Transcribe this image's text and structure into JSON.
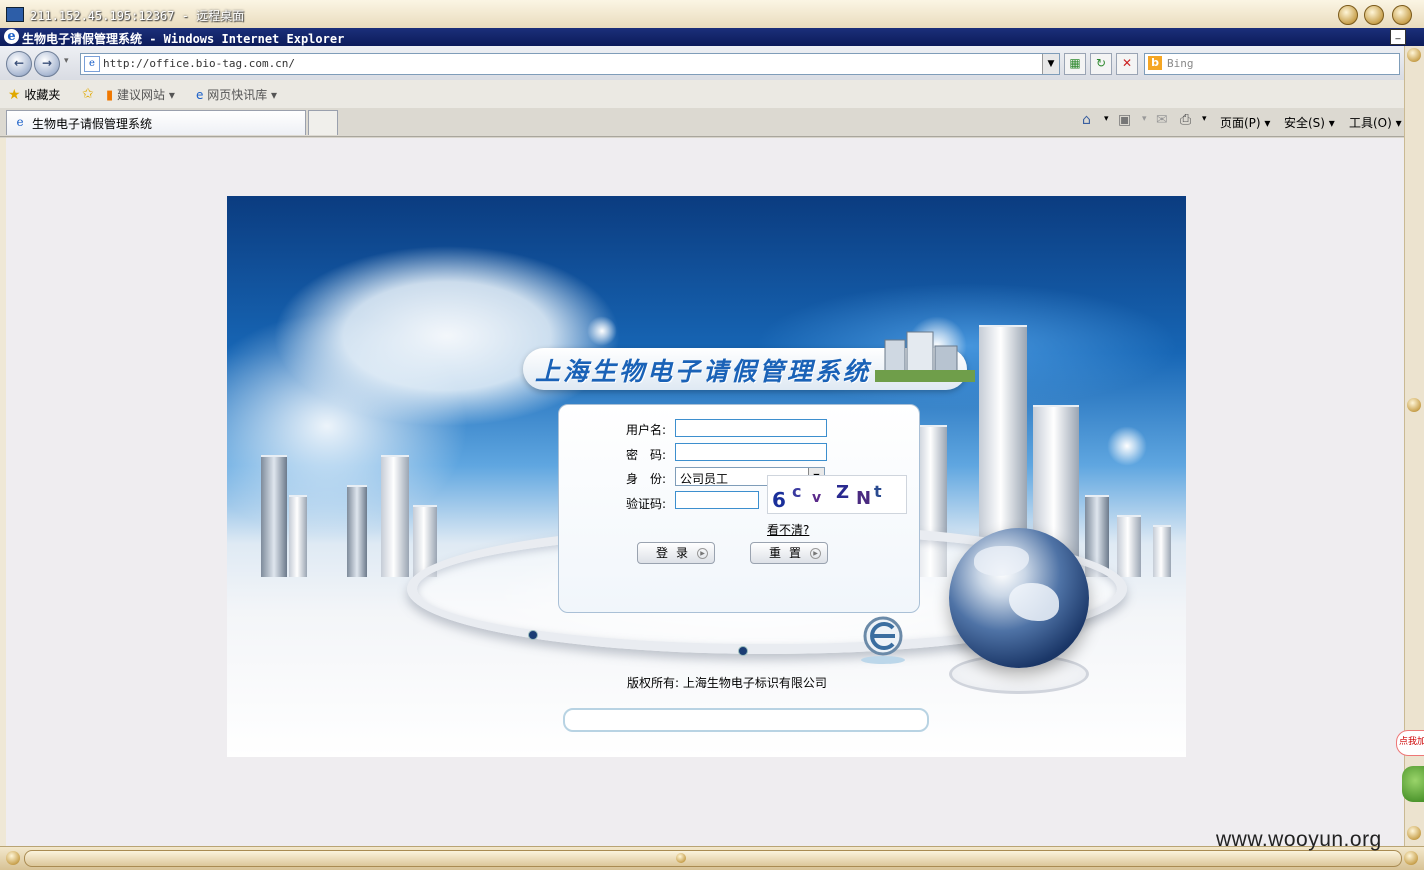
{
  "remote_desktop": {
    "title": "211.152.45.195:12367 - 远程桌面"
  },
  "browser": {
    "window_title": "生物电子请假管理系统 - Windows Internet Explorer",
    "address": "http://office.bio-tag.com.cn/",
    "search_placeholder": "Bing",
    "favorites": {
      "label": "收藏夹",
      "items": [
        "建议网站",
        "网页快讯库"
      ]
    },
    "tab_title": "生物电子请假管理系统",
    "commands": {
      "page": "页面(P)",
      "safety": "安全(S)",
      "tools": "工具(O)"
    }
  },
  "login": {
    "system_title": "上海生物电子请假管理系统",
    "username_label": "用户名:",
    "password_label": "密　码:",
    "role_label": "身　份:",
    "role_value": "公司员工",
    "captcha_label": "验证码:",
    "captcha_chars": [
      "6",
      "c",
      "v",
      "Z",
      "N",
      "t"
    ],
    "refresh_link": "看不清?",
    "login_button": "登录",
    "reset_button": "重置",
    "copyright": "版权所有: 上海生物电子标识有限公司"
  },
  "overlay": {
    "watermark": "www.wooyun.org",
    "side_badge": "点我加"
  }
}
